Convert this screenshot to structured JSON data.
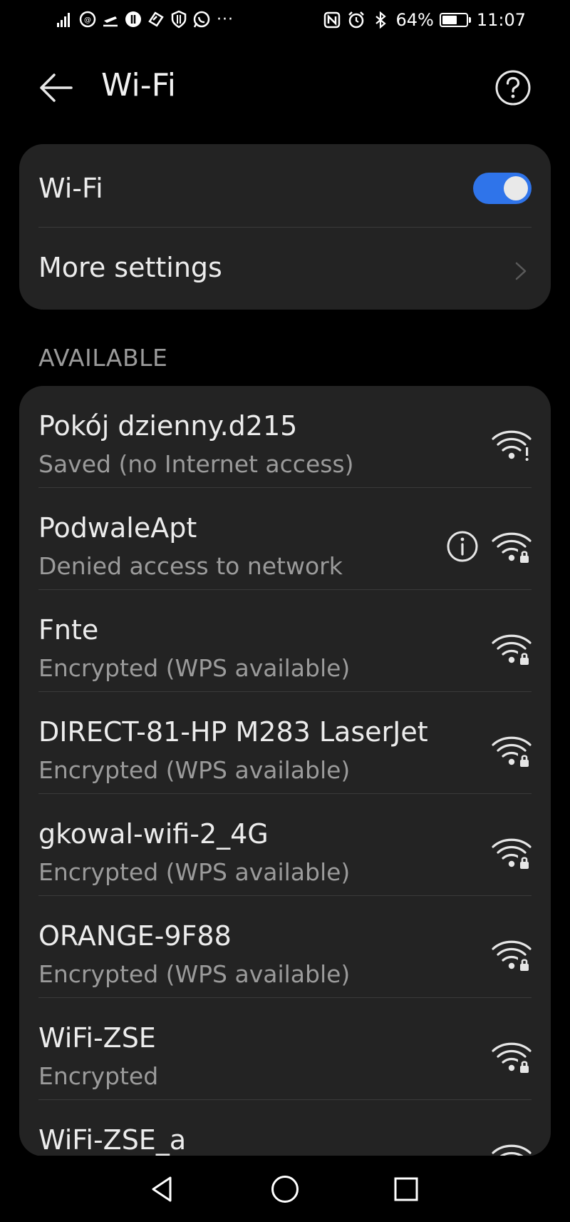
{
  "status_bar": {
    "battery_percent": "64%",
    "time": "11:07",
    "left_icons": [
      "signal-icon",
      "wifi-call-icon",
      "airplane-icon",
      "messenger-icon",
      "app-icon",
      "shield-icon",
      "whatsapp-icon"
    ],
    "overflow": "···",
    "right_icons": [
      "nfc-icon",
      "alarm-icon",
      "bluetooth-icon"
    ],
    "battery_level": 0.64
  },
  "header": {
    "title": "Wi-Fi"
  },
  "wifi_card": {
    "toggle_label": "Wi-Fi",
    "toggle_on": true,
    "more_settings_label": "More settings"
  },
  "available": {
    "section_label": "AVAILABLE",
    "networks": [
      {
        "name": "Pokój dzienny.d215",
        "status": "Saved (no Internet access)",
        "icon": "wifi-warning-icon",
        "has_info": false
      },
      {
        "name": "PodwaleApt",
        "status": "Denied access to network",
        "icon": "wifi-lock-icon",
        "has_info": true
      },
      {
        "name": "Fnte",
        "status": "Encrypted (WPS available)",
        "icon": "wifi-lock-icon",
        "has_info": false
      },
      {
        "name": "DIRECT-81-HP M283 LaserJet",
        "status": "Encrypted (WPS available)",
        "icon": "wifi-lock-icon",
        "has_info": false
      },
      {
        "name": "gkowal-wifi-2_4G",
        "status": "Encrypted (WPS available)",
        "icon": "wifi-lock-icon",
        "has_info": false
      },
      {
        "name": "ORANGE-9F88",
        "status": "Encrypted (WPS available)",
        "icon": "wifi-lock-icon",
        "has_info": false
      },
      {
        "name": "WiFi-ZSE",
        "status": "Encrypted",
        "icon": "wifi-lock-icon",
        "has_info": false
      },
      {
        "name": "WiFi-ZSE_a",
        "status": "",
        "icon": "wifi-icon",
        "has_info": false
      }
    ]
  },
  "nav": {
    "buttons": [
      "back-nav-icon",
      "home-nav-icon",
      "recents-nav-icon"
    ]
  },
  "colors": {
    "background": "#000000",
    "card": "#232323",
    "accent": "#2f74ea",
    "primary_text": "#ececec",
    "secondary_text": "#9b9b9b"
  }
}
